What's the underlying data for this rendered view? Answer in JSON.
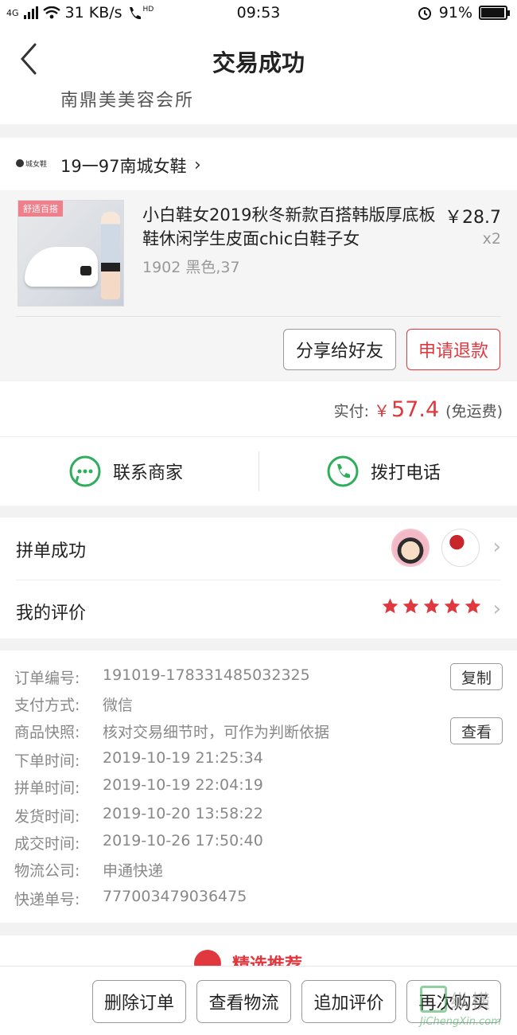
{
  "status_bar": {
    "network": "4G",
    "speed": "31 KB/s",
    "hd": "HD",
    "time": "09:53",
    "battery": "91%",
    "battery_level": 0.91
  },
  "header": {
    "title": "交易成功",
    "address_partial": "南鼎美美容会所"
  },
  "shop": {
    "name": "19一97南城女鞋",
    "logo_text": "城女鞋"
  },
  "product": {
    "image_tag": "舒适百搭",
    "title": "小白鞋女2019秋冬新款百搭韩版厚底板鞋休闲学生皮面chic白鞋子女",
    "price": "￥28.7",
    "quantity": "x2",
    "sku": "1902 黑色,37",
    "share_label": "分享给好友",
    "refund_label": "申请退款"
  },
  "payment": {
    "label": "实付:",
    "currency": "￥",
    "amount": "57.4",
    "shipping": "(免运费)"
  },
  "contact": {
    "merchant_label": "联系商家",
    "call_label": "拨打电话"
  },
  "group": {
    "group_label": "拼单成功",
    "review_label": "我的评价",
    "rating": 5
  },
  "order_info": {
    "rows": [
      {
        "key": "订单编号:",
        "value": "191019-178331485032325"
      },
      {
        "key": "支付方式:",
        "value": "微信"
      },
      {
        "key": "商品快照:",
        "value": "核对交易细节时，可作为判断依据"
      },
      {
        "key": "下单时间:",
        "value": "2019-10-19 21:25:34"
      },
      {
        "key": "拼单时间:",
        "value": "2019-10-19 22:04:19"
      },
      {
        "key": "发货时间:",
        "value": "2019-10-20 13:58:22"
      },
      {
        "key": "成交时间:",
        "value": "2019-10-26 17:50:40"
      },
      {
        "key": "物流公司:",
        "value": "申通快递"
      },
      {
        "key": "快递单号:",
        "value": "777003479036475"
      }
    ],
    "copy_label": "复制",
    "view_label": "查看"
  },
  "recommend": {
    "title": "精选推荐"
  },
  "bottom_bar": {
    "delete_label": "删除订单",
    "logistics_label": "查看物流",
    "add_review_label": "追加评价",
    "buy_again_label": "再次购买"
  },
  "watermark": {
    "text": "纵横",
    "url": "JiChengXin.com"
  },
  "colors": {
    "accent_red": "#e0383e",
    "contact_green": "#2eae5c",
    "background": "#f2f2f2"
  }
}
